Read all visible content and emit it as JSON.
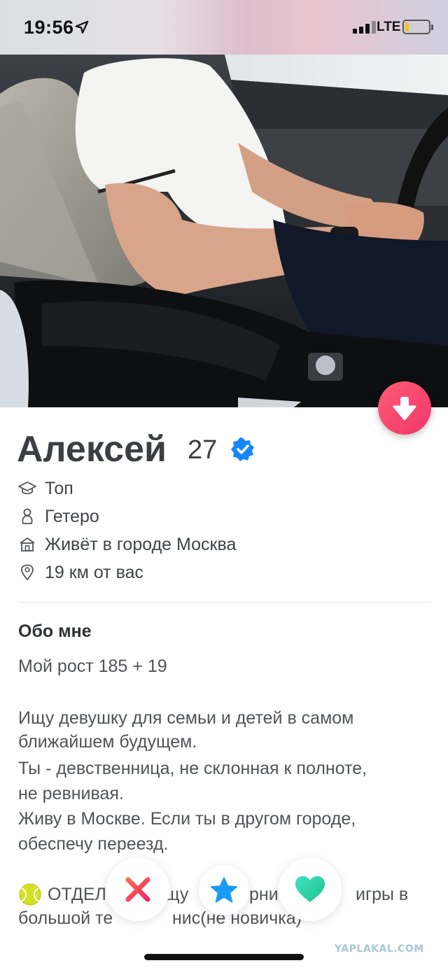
{
  "status_bar": {
    "time": "19:56",
    "network": "LTE"
  },
  "profile": {
    "name": "Алексей",
    "age": "27",
    "info": [
      {
        "icon": "graduation-cap-icon",
        "text": "Топ"
      },
      {
        "icon": "person-icon",
        "text": "Гетеро"
      },
      {
        "icon": "home-icon",
        "text": "Живёт в городе Москва"
      },
      {
        "icon": "location-pin-icon",
        "text": "19 км от вас"
      }
    ]
  },
  "about": {
    "heading": "Обо мне",
    "lines": [
      "Мой рост 185 + 19",
      "Ищу девушку для семьи и детей в самом",
      "ближайшем будущем.",
      "Ты - девственница, не склонная к полноте,",
      "не ревнивая.",
      "Живу в Москве. Если ты в другом городе,",
      "обеспечу переезд.",
      "ОТДЕЛ",
      "щу",
      "рни",
      "игры в",
      "большой те",
      "нис(не новичка)"
    ]
  },
  "actions": {
    "collapse": "arrow-down-icon",
    "dislike": "close-icon",
    "super_like": "star-icon",
    "like": "heart-icon"
  },
  "watermark": "YAPLAKAL.COM",
  "colors": {
    "accent": "#f0366c",
    "verified": "#1786ff",
    "dislike": "#f23c59",
    "super_like": "#1a9af5",
    "like": "#2bd4a6"
  }
}
